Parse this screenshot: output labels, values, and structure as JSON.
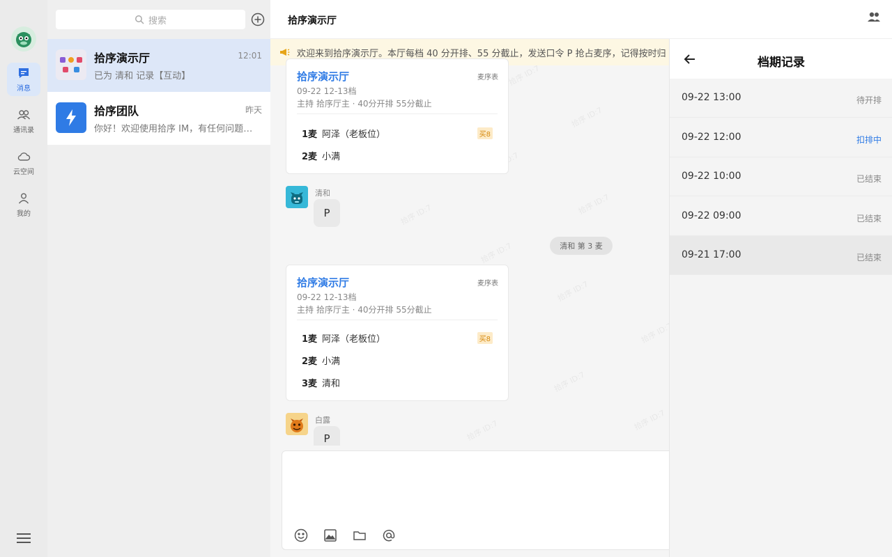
{
  "rail": {
    "items": [
      {
        "label": "消息"
      },
      {
        "label": "通讯录"
      },
      {
        "label": "云空间"
      },
      {
        "label": "我的"
      }
    ]
  },
  "search": {
    "placeholder": "搜索"
  },
  "conversations": [
    {
      "name": "拾序演示厅",
      "time": "12:01",
      "preview": "已为 清和 记录【互动】"
    },
    {
      "name": "拾序团队",
      "time": "昨天",
      "preview": "你好！欢迎使用拾序 IM，有任何问题可…"
    }
  ],
  "chat": {
    "title": "拾序演示厅",
    "notice": "欢迎来到拾序演示厅。本厅每档 40 分开排、55 分截止，发送口令 P 抢占麦序，记得按时归",
    "card1": {
      "title": "拾序演示厅",
      "tag": "麦序表",
      "slot": "09-22 12-13档",
      "info": "主持 拾序厅主 · 40分开排 55分截止",
      "rows": [
        {
          "mic": "1麦",
          "name": "阿泽（老板位）",
          "badge": "买8"
        },
        {
          "mic": "2麦",
          "name": "小满"
        }
      ]
    },
    "msg1": {
      "sender": "清和",
      "text": "P"
    },
    "system": "清和 第 3 麦",
    "card2": {
      "title": "拾序演示厅",
      "tag": "麦序表",
      "slot": "09-22 12-13档",
      "info": "主持 拾序厅主 · 40分开排 55分截止",
      "rows": [
        {
          "mic": "1麦",
          "name": "阿泽（老板位）",
          "badge": "买8"
        },
        {
          "mic": "2麦",
          "name": "小满"
        },
        {
          "mic": "3麦",
          "name": "清和"
        }
      ]
    },
    "msg2": {
      "sender": "白露",
      "text": "P"
    },
    "watermark": "拾序 ID:7"
  },
  "panel": {
    "title": "档期记录",
    "records": [
      {
        "time": "09-22 13:00",
        "status": "待开排"
      },
      {
        "time": "09-22 12:00",
        "status": "扣排中"
      },
      {
        "time": "09-22 10:00",
        "status": "已结束"
      },
      {
        "time": "09-22 09:00",
        "status": "已结束"
      },
      {
        "time": "09-21 17:00",
        "status": "已结束"
      }
    ]
  },
  "colors": {
    "accent": "#2f7be5",
    "brand": "#1f8a5a",
    "notice_bg": "#fdf7e3"
  }
}
